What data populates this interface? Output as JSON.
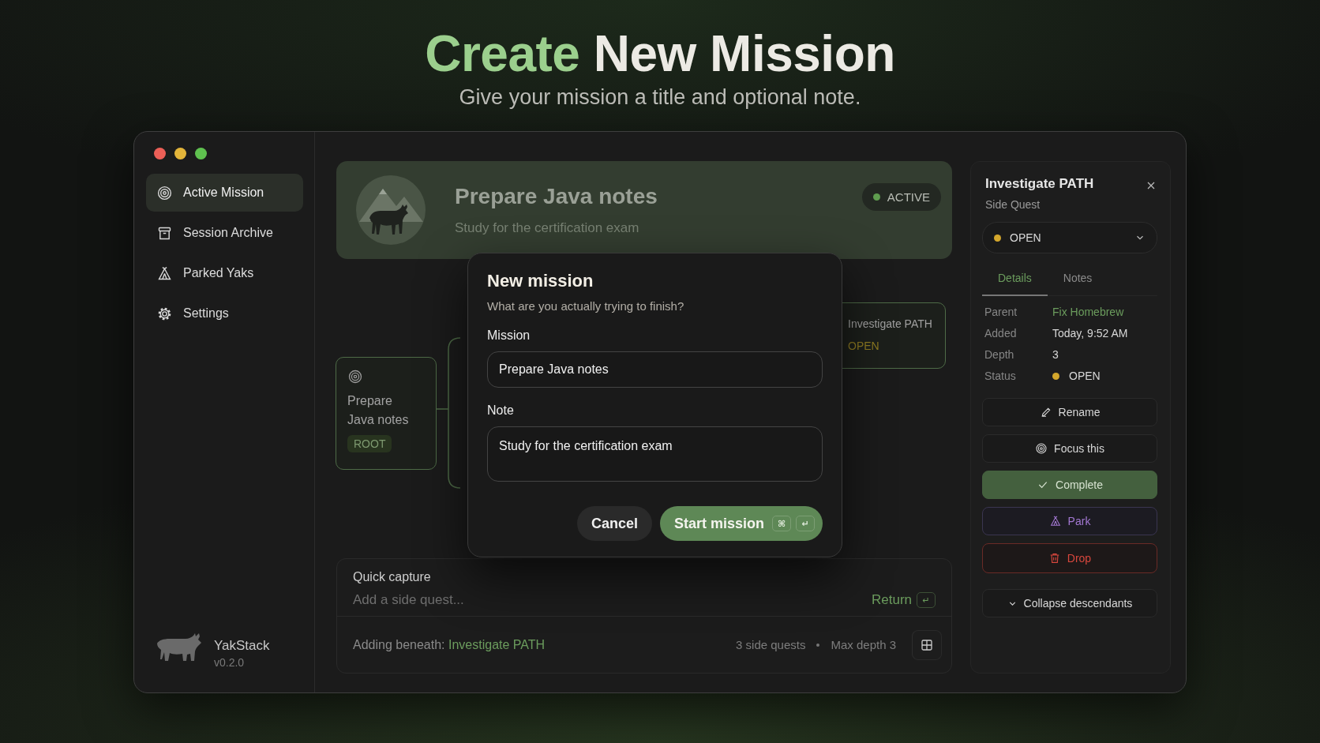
{
  "heading": {
    "accent": "Create",
    "title": "New Mission",
    "subtitle": "Give your mission a title and optional note."
  },
  "sidebar": {
    "items": [
      {
        "label": "Active Mission",
        "selected": true
      },
      {
        "label": "Session Archive",
        "selected": false
      },
      {
        "label": "Parked Yaks",
        "selected": false
      },
      {
        "label": "Settings",
        "selected": false
      }
    ],
    "app_name": "YakStack",
    "version": "v0.2.0"
  },
  "mission_card": {
    "title": "Prepare Java notes",
    "subtitle": "Study for the certification exam",
    "status": "ACTIVE"
  },
  "canvas": {
    "root": {
      "title": "Prepare Java notes",
      "badge": "ROOT"
    },
    "node": {
      "title": "Investigate PATH",
      "status": "OPEN"
    }
  },
  "dialog": {
    "title": "New mission",
    "subtitle": "What are you actually trying to finish?",
    "fields": [
      {
        "label": "Mission",
        "value": "Prepare Java notes",
        "kind": "line"
      },
      {
        "label": "Note",
        "value": "Study for the certification exam",
        "kind": "area"
      }
    ],
    "cancel": "Cancel",
    "submit": "Start mission",
    "shortcut": [
      "⌘",
      "↵"
    ]
  },
  "quick_capture": {
    "title": "Quick capture",
    "placeholder": "Add a side quest...",
    "submit": "Return",
    "submit_key": "↵",
    "context_label": "Adding beneath:",
    "context_value": "Investigate PATH",
    "stats": [
      "3 side quests",
      "Max depth 3"
    ]
  },
  "details": {
    "title": "Investigate PATH",
    "subtitle": "Side Quest",
    "status": "OPEN",
    "tabs": [
      {
        "label": "Details",
        "selected": true
      },
      {
        "label": "Notes",
        "selected": false
      }
    ],
    "fields": [
      {
        "label": "Parent",
        "value": "Fix Homebrew",
        "kind": "link"
      },
      {
        "label": "Added",
        "value": "Today, 9:52 AM",
        "kind": "text"
      },
      {
        "label": "Depth",
        "value": "3",
        "kind": "text"
      },
      {
        "label": "Status",
        "value": "OPEN",
        "kind": "status"
      }
    ],
    "actions": [
      {
        "label": "Rename",
        "kind": "rename"
      },
      {
        "label": "Focus this",
        "kind": "focus"
      },
      {
        "label": "Complete",
        "kind": "complete"
      },
      {
        "label": "Park",
        "kind": "park"
      },
      {
        "label": "Drop",
        "kind": "drop"
      }
    ],
    "collapse": "Collapse descendants"
  }
}
